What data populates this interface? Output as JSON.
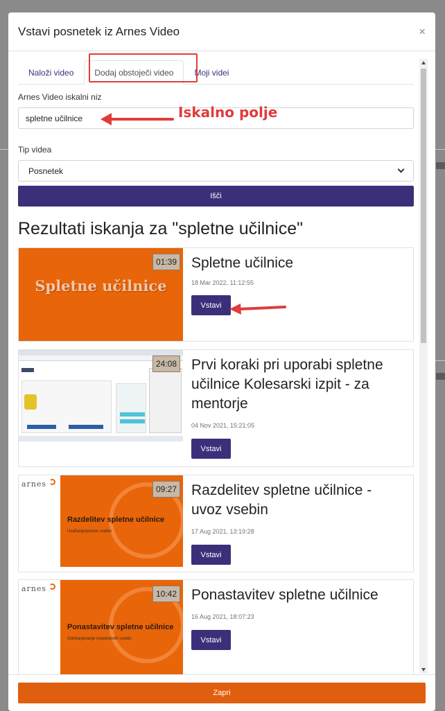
{
  "dialog": {
    "title": "Vstavi posnetek iz Arnes Video",
    "close_symbol": "×"
  },
  "tabs": [
    {
      "label": "Naloži video",
      "active": false
    },
    {
      "label": "Dodaj obstoječi video",
      "active": true
    },
    {
      "label": "Moji videi",
      "active": false
    }
  ],
  "search": {
    "label": "Arnes Video iskalni niz",
    "value": "spletne učilnice",
    "annotation": "Iskalno polje"
  },
  "video_type": {
    "label": "Tip videa",
    "selected": "Posnetek"
  },
  "search_button": "Išči",
  "results_heading": "Rezultati iskanja za \"spletne učilnice\"",
  "results": [
    {
      "title": "Spletne učilnice",
      "date": "18 Mar 2022, 11:12:55",
      "duration": "01:39",
      "thumb_text": "Spletne učilnice",
      "button": "Vstavi"
    },
    {
      "title": "Prvi koraki pri uporabi spletne učilnice Kolesarski izpit - za mentorje",
      "date": "04 Nov 2021, 15:21:05",
      "duration": "24:08",
      "button": "Vstavi"
    },
    {
      "title": "Razdelitev spletne učilnice - uvoz vsebin",
      "date": "17 Aug 2021, 13:19:28",
      "duration": "09:27",
      "thumb_brand": "arnes",
      "thumb_title": "Razdelitev spletne učilnice",
      "thumb_subtitle": "Uvažanje/prenos vsebin",
      "button": "Vstavi"
    },
    {
      "title": "Ponastavitev spletne učilnice",
      "date": "16 Aug 2021, 18:07:23",
      "duration": "10:42",
      "thumb_brand": "arnes",
      "thumb_title": "Ponastavitev spletne učilnice",
      "thumb_subtitle": "Odstranjevanje nepotrebnih vsebin",
      "button": "Vstavi"
    }
  ],
  "footer_button": "Zapri",
  "colors": {
    "primary": "#3c2f7a",
    "orange": "#e05f0f",
    "thumb_orange": "#e8650a",
    "annotation_red": "#e03c3c"
  }
}
